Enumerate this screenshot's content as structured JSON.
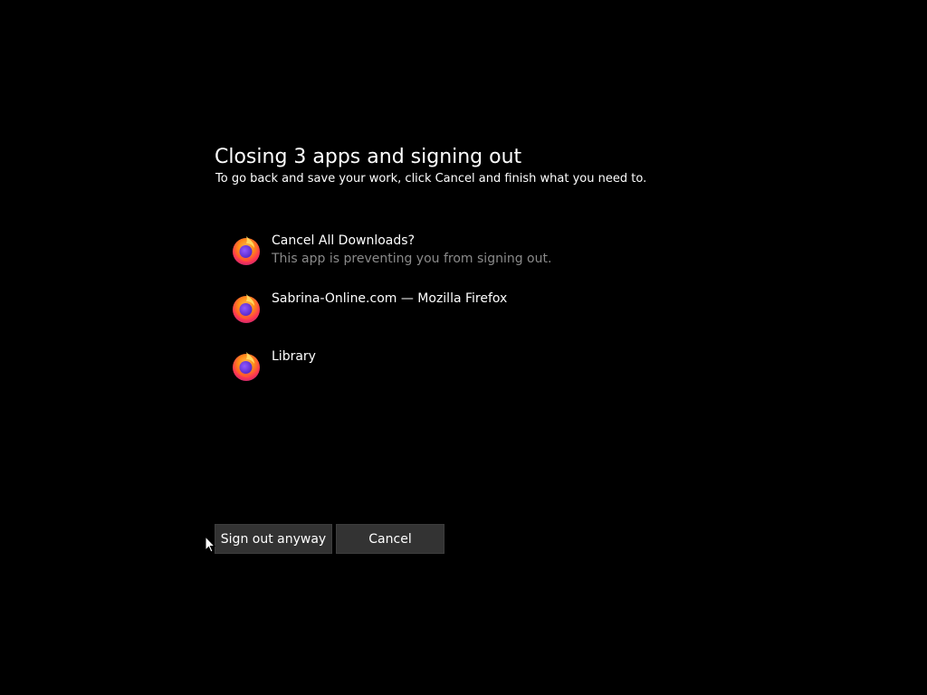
{
  "dialog": {
    "title": "Closing 3 apps and signing out",
    "subtitle": "To go back and save your work, click Cancel and finish what you need to."
  },
  "apps": [
    {
      "icon": "firefox-icon",
      "name": "Cancel All Downloads?",
      "status": "This app is preventing you from signing out."
    },
    {
      "icon": "firefox-icon",
      "name": "Sabrina-Online.com — Mozilla Firefox",
      "status": ""
    },
    {
      "icon": "firefox-icon",
      "name": "Library",
      "status": ""
    }
  ],
  "buttons": {
    "sign_out_label": "Sign out anyway",
    "cancel_label": "Cancel"
  },
  "colors": {
    "background": "#000000",
    "button_bg": "#333333",
    "secondary_text": "#8a8a8a"
  }
}
